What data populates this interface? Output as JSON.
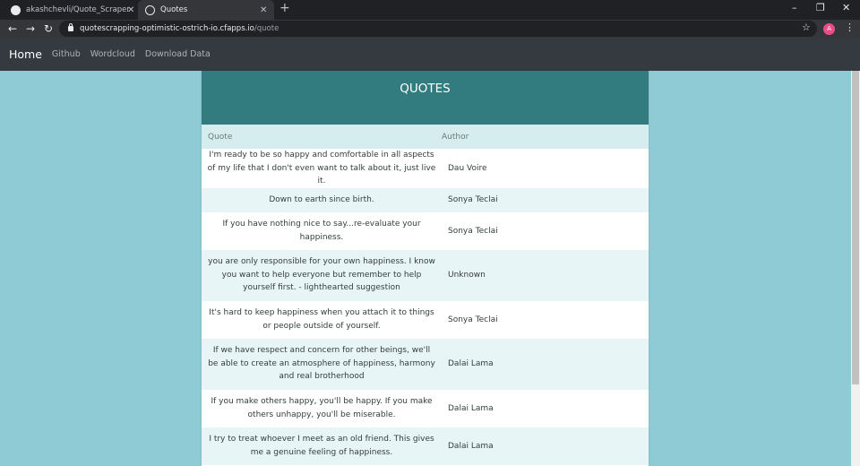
{
  "browser": {
    "tabs": [
      {
        "title": "akashchevli/Quote_Scraper",
        "active": false,
        "icon": "github-icon"
      },
      {
        "title": "Quotes",
        "active": true,
        "icon": "globe-icon"
      }
    ],
    "new_tab_label": "+",
    "window_controls": {
      "minimize": "–",
      "restore": "❐",
      "close": "✕"
    },
    "url_host": "quotescrapping-optimistic-ostrich-io.cfapps.io",
    "url_path": "/quote",
    "profile_initial": "A"
  },
  "navbar": {
    "brand": "Home",
    "links": [
      "Github",
      "Wordcloud",
      "Download Data"
    ]
  },
  "card": {
    "title": "QUOTES",
    "columns": {
      "quote": "Quote",
      "author": "Author"
    },
    "rows": [
      {
        "quote": "I'm ready to be so happy and comfortable in all aspects of my life that I don't even want to talk about it, just live it.",
        "author": "Dau Voire"
      },
      {
        "quote": "Down to earth since birth.",
        "author": "Sonya Teclai"
      },
      {
        "quote": "If you have nothing nice to say...re-evaluate your happiness.",
        "author": "Sonya Teclai"
      },
      {
        "quote": "you are only responsible for your own happiness. I know you want to help everyone but remember to help yourself first. - lighthearted suggestion",
        "author": "Unknown"
      },
      {
        "quote": "It's hard to keep happiness when you attach it to things or people outside of yourself.",
        "author": "Sonya Teclai"
      },
      {
        "quote": "If we have respect and concern for other beings, we'll be able to create an atmosphere of happiness, harmony and real brotherhood",
        "author": "Dalai Lama"
      },
      {
        "quote": "If you make others happy, you'll be happy. If you make others unhappy, you'll be miserable.",
        "author": "Dalai Lama"
      },
      {
        "quote": "I try to treat whoever I meet as an old friend. This gives me a genuine feeling of happiness.",
        "author": "Dalai Lama"
      }
    ]
  },
  "colors": {
    "page_background": "#8fcbd4",
    "header_teal": "#327b7f",
    "navbar": "#343a40"
  }
}
